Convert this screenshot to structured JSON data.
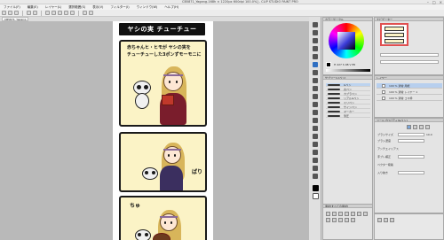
{
  "window": {
    "title": "CB5871_Yagang-168h × 1220px 600dpi 100.0%] - CLIP STUDIO PAINT PRO",
    "min": "–",
    "max": "□",
    "close": "×"
  },
  "menu": [
    "ファイル(F)",
    "編集(E)",
    "レイヤー(L)",
    "選択範囲(S)",
    "表示(V)",
    "フィルター(I)",
    "ウィンドウ(W)",
    "ヘルプ(H)"
  ],
  "tab": {
    "label": "CB5871_Yagang..."
  },
  "comic": {
    "header": "ヤシの実 チューチュー",
    "panel1_line1": "赤ちゃんヒ・ヒモが ヤシの実を",
    "panel1_line2": "チューチューした3ポンずモーモニに",
    "sfx_panel2": "ぱり",
    "sfx_panel3": "ちゅ"
  },
  "color_panel": {
    "title": "カラーサークル",
    "value": "H 227 S 98 V 85"
  },
  "navigator": {
    "title": "ナビゲーター"
  },
  "subtool": {
    "title": "サブツール[ペン]",
    "items": [
      "Gペン",
      "丸ペン",
      "カブラペン",
      "リアルGペン",
      "ミリペン",
      "サインペン",
      "マーカー",
      "筆圧"
    ]
  },
  "layers": {
    "title": "レイヤー",
    "rows": [
      "100 % 通常  用紙",
      "100 % 通常  レイヤー 1",
      "100 % 通常  コマ枠"
    ]
  },
  "properties": {
    "title": "ツールプロパティ[Gペン]",
    "labels": [
      "ブラシサイズ",
      "ブラシ濃度",
      "アンチエイリアス",
      "手ブレ補正",
      "ベクター吸着",
      "入り抜き"
    ],
    "size_value": "10.0"
  },
  "library": {
    "title": "素材[すべての素材]"
  },
  "colors": {
    "accent": "#e05050",
    "selection": "#b7cfee"
  }
}
